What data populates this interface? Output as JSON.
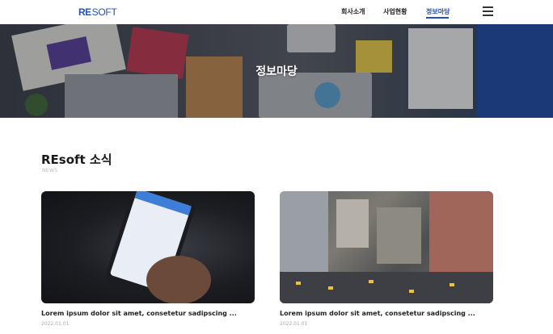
{
  "header": {
    "logo_mark": "RE",
    "logo_text": "SOFT",
    "nav": [
      {
        "label": "회사소개"
      },
      {
        "label": "사업현황"
      },
      {
        "label": "정보마당",
        "active": true
      }
    ],
    "menu_icon": "hamburger-menu-icon",
    "accent_color": "#2451b7"
  },
  "hero": {
    "title": "정보마당",
    "image": "desk-with-laptop-tablet-charts"
  },
  "section": {
    "title": "REsoft 소식",
    "subtitle": "NEWS"
  },
  "cards": [
    {
      "image": "hand-holding-smartphone-messaging",
      "title": "Lorem ipsum dolor sit amet, consetetur sadipscing ...",
      "date": "2022.01.01"
    },
    {
      "image": "aerial-city-street-taxis",
      "title": "Lorem ipsum dolor sit amet, consetetur sadipscing ...",
      "date": "2022.01.01"
    }
  ]
}
